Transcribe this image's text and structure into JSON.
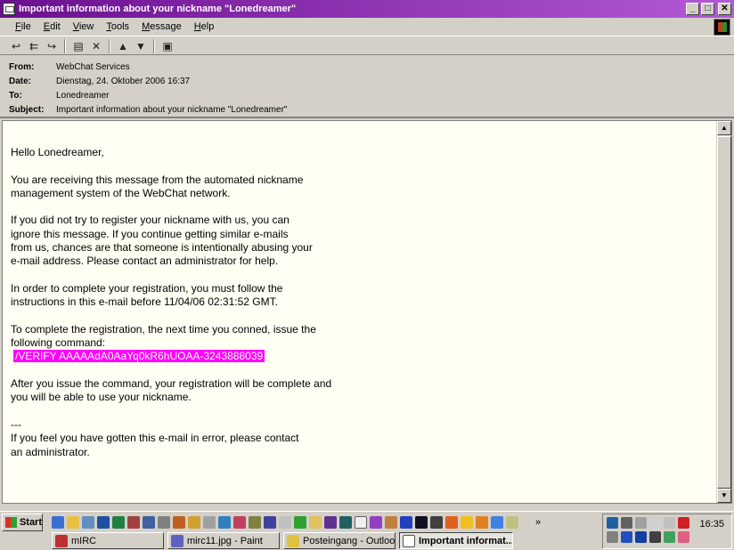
{
  "window": {
    "title": "Important information about your nickname \"Lonedreamer\"",
    "minimize": "_",
    "maximize": "□",
    "close": "✕"
  },
  "menu": [
    "File",
    "Edit",
    "View",
    "Tools",
    "Message",
    "Help"
  ],
  "toolbar": {
    "icons": [
      "reply-icon",
      "reply-all-icon",
      "forward-icon",
      "print-icon",
      "delete-icon",
      "previous-icon",
      "next-icon",
      "address-book-icon"
    ]
  },
  "header": {
    "from_label": "From:",
    "from": "WebChat Services",
    "date_label": "Date:",
    "date": "Dienstag, 24. Oktober 2006 16:37",
    "to_label": "To:",
    "to": "Lonedreamer",
    "subject_label": "Subject:",
    "subject": "Important information about your nickname \"Lonedreamer\""
  },
  "message": {
    "greeting": "Hello Lonedreamer,",
    "para1": "You are receiving this message from the automated nickname\nmanagement system of the WebChat network.",
    "para2": "If you did not try to register your nickname with us, you can\nignore this message. If you continue getting similar e-mails\nfrom us, chances are that someone is intentionally abusing your\ne-mail address. Please contact an administrator for help.",
    "para3": "In order to complete your registration, you must follow the\ninstructions in this e-mail before 11/04/06 02:31:52 GMT.",
    "para4": "To complete the registration, the next time you conned, issue the\nfollowing command:",
    "command": "/VERIFY AAAAAdA0AaYq0kR6hUOAA-3243888039",
    "para5": "After you issue the command, your registration will be complete and\nyou will be able to use your nickname.",
    "signature_sep": "---",
    "para6": "If you feel you have gotten this e-mail in error, please contact\nan administrator."
  },
  "taskbar": {
    "start": "Start",
    "clock": "16:35",
    "tasks": [
      {
        "label": "mIRC",
        "icon": "mirc-icon"
      },
      {
        "label": "mirc11.jpg - Paint",
        "icon": "paint-icon"
      },
      {
        "label": "Posteingang - Outloo...",
        "icon": "outlook-icon"
      },
      {
        "label": "Important informat...",
        "icon": "mail-message-icon",
        "active": true
      }
    ]
  },
  "colors": {
    "title_gradient_start": "#6a0f8e",
    "title_gradient_end": "#b45ad6",
    "command_highlight": "#ff00ff",
    "message_background": "#fffff4"
  }
}
